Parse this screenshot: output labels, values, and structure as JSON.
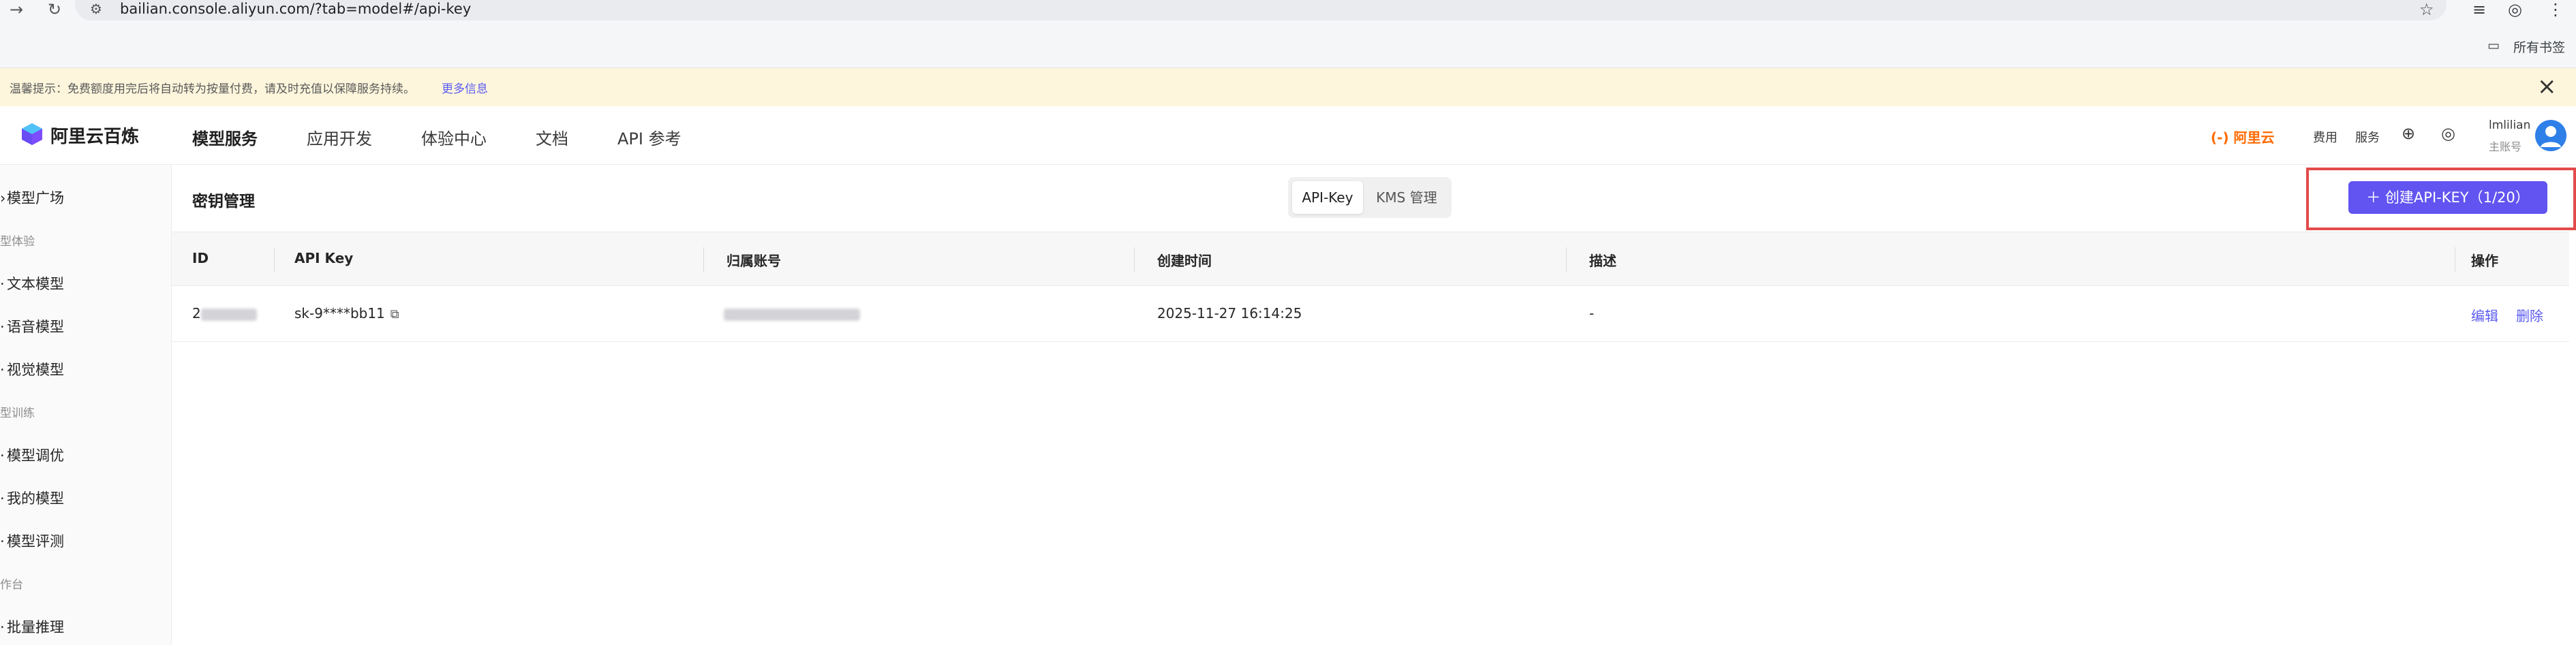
{
  "browser": {
    "back_icon": "→",
    "reload_icon": "↻",
    "site_icon": "⚙",
    "url": "bailian.console.aliyun.com/?tab=model#/api-key",
    "star_icon": "☆",
    "bookmarks_label": "所有书签"
  },
  "notice": {
    "text": "温馨提示：免费额度用完后将自动转为按量付费，请及时充值以保障服务持续。",
    "link": "更多信息"
  },
  "header": {
    "logo": "阿里云百炼",
    "nav": [
      "模型服务",
      "应用开发",
      "体验中心",
      "文档",
      "API 参考"
    ],
    "active_nav": "模型服务",
    "aliyun": "(-) 阿里云",
    "links": [
      "费用",
      "服务"
    ],
    "user_name": "lmlilian",
    "user_role": "主账号"
  },
  "sidebar": {
    "items": [
      {
        "label": "模型广场",
        "type": "item"
      },
      {
        "label": "型体验",
        "type": "group"
      },
      {
        "label": "文本模型",
        "type": "item"
      },
      {
        "label": "语音模型",
        "type": "item"
      },
      {
        "label": "视觉模型",
        "type": "item"
      },
      {
        "label": "型训练",
        "type": "group"
      },
      {
        "label": "模型调优",
        "type": "item"
      },
      {
        "label": "我的模型",
        "type": "item"
      },
      {
        "label": "模型评测",
        "type": "item"
      },
      {
        "label": "作台",
        "type": "group"
      },
      {
        "label": "批量推理",
        "type": "item"
      }
    ]
  },
  "main": {
    "title": "密钥管理",
    "tabs": [
      "API-Key",
      "KMS 管理"
    ],
    "active_tab": "API-Key",
    "create_button": "创建API-KEY（1/20）"
  },
  "table": {
    "columns": [
      "ID",
      "API Key",
      "归属账号",
      "创建时间",
      "描述",
      "操作"
    ],
    "rows": [
      {
        "id_prefix": "2",
        "api_key": "sk-9****bb11",
        "created": "2025-11-27 16:14:25",
        "description": "-",
        "actions": [
          "编辑",
          "删除"
        ]
      }
    ]
  },
  "colors": {
    "accent": "#6254f0",
    "link": "#5b5bf2",
    "notice_bg": "#fdf6dc",
    "highlight": "#e34a4a",
    "brand_orange": "#ff6a00"
  }
}
